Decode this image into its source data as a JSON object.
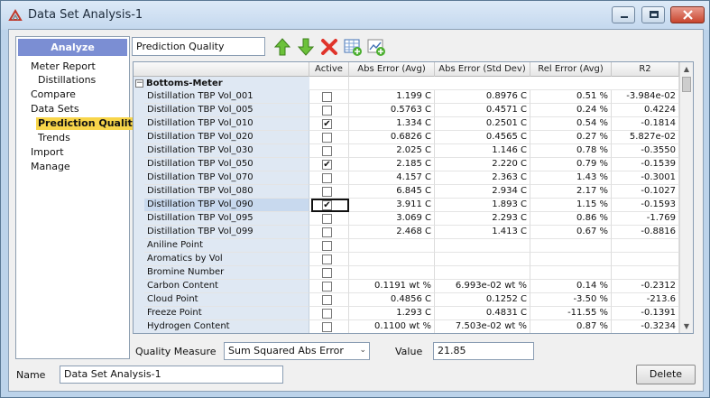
{
  "window": {
    "title": "Data Set Analysis-1"
  },
  "nav": {
    "header": "Analyze",
    "items": [
      {
        "label": "Meter Report",
        "level": 0,
        "selected": false
      },
      {
        "label": "Distillations",
        "level": 1,
        "selected": false
      },
      {
        "label": "Compare",
        "level": 0,
        "selected": false
      },
      {
        "label": "Data Sets",
        "level": 0,
        "selected": false
      },
      {
        "label": "Prediction Quality",
        "level": 1,
        "selected": true
      },
      {
        "label": "Trends",
        "level": 1,
        "selected": false
      },
      {
        "label": "Import",
        "level": 0,
        "selected": false
      },
      {
        "label": "Manage",
        "level": 0,
        "selected": false
      }
    ]
  },
  "toolbar": {
    "profile_value": "Prediction Quality",
    "icons": [
      "move-up-icon",
      "move-down-icon",
      "delete-icon",
      "add-column-icon",
      "add-chart-icon"
    ]
  },
  "grid": {
    "columns": [
      "",
      "Active",
      "Abs Error (Avg)",
      "Abs Error (Std Dev)",
      "Rel Error (Avg)",
      "R2"
    ],
    "group": "Bottoms-Meter",
    "rows": [
      {
        "name": "Distillation TBP Vol_001",
        "active": false,
        "abs_avg": "1.199 C",
        "abs_std": "0.8976 C",
        "rel_avg": "0.51 %",
        "r2": "-3.984e-02"
      },
      {
        "name": "Distillation TBP Vol_005",
        "active": false,
        "abs_avg": "0.5763 C",
        "abs_std": "0.4571 C",
        "rel_avg": "0.24 %",
        "r2": "0.4224"
      },
      {
        "name": "Distillation TBP Vol_010",
        "active": true,
        "abs_avg": "1.334 C",
        "abs_std": "0.2501 C",
        "rel_avg": "0.54 %",
        "r2": "-0.1814"
      },
      {
        "name": "Distillation TBP Vol_020",
        "active": false,
        "abs_avg": "0.6826 C",
        "abs_std": "0.4565 C",
        "rel_avg": "0.27 %",
        "r2": "5.827e-02"
      },
      {
        "name": "Distillation TBP Vol_030",
        "active": false,
        "abs_avg": "2.025 C",
        "abs_std": "1.146 C",
        "rel_avg": "0.78 %",
        "r2": "-0.3550"
      },
      {
        "name": "Distillation TBP Vol_050",
        "active": true,
        "abs_avg": "2.185 C",
        "abs_std": "2.220 C",
        "rel_avg": "0.79 %",
        "r2": "-0.1539"
      },
      {
        "name": "Distillation TBP Vol_070",
        "active": false,
        "abs_avg": "4.157 C",
        "abs_std": "2.363 C",
        "rel_avg": "1.43 %",
        "r2": "-0.3001"
      },
      {
        "name": "Distillation TBP Vol_080",
        "active": false,
        "abs_avg": "6.845 C",
        "abs_std": "2.934 C",
        "rel_avg": "2.17 %",
        "r2": "-0.1027"
      },
      {
        "name": "Distillation TBP Vol_090",
        "active": true,
        "selected": true,
        "abs_avg": "3.911 C",
        "abs_std": "1.893 C",
        "rel_avg": "1.15 %",
        "r2": "-0.1593"
      },
      {
        "name": "Distillation TBP Vol_095",
        "active": false,
        "abs_avg": "3.069 C",
        "abs_std": "2.293 C",
        "rel_avg": "0.86 %",
        "r2": "-1.769"
      },
      {
        "name": "Distillation TBP Vol_099",
        "active": false,
        "abs_avg": "2.468 C",
        "abs_std": "1.413 C",
        "rel_avg": "0.67 %",
        "r2": "-0.8816"
      },
      {
        "name": "Aniline Point",
        "active": false,
        "abs_avg": "",
        "abs_std": "",
        "rel_avg": "",
        "r2": ""
      },
      {
        "name": "Aromatics by Vol",
        "active": false,
        "abs_avg": "",
        "abs_std": "",
        "rel_avg": "",
        "r2": ""
      },
      {
        "name": "Bromine Number",
        "active": false,
        "abs_avg": "",
        "abs_std": "",
        "rel_avg": "",
        "r2": ""
      },
      {
        "name": "Carbon Content",
        "active": false,
        "abs_avg": "0.1191 wt %",
        "abs_std": "6.993e-02 wt %",
        "rel_avg": "0.14 %",
        "r2": "-0.2312"
      },
      {
        "name": "Cloud Point",
        "active": false,
        "abs_avg": "0.4856 C",
        "abs_std": "0.1252 C",
        "rel_avg": "-3.50 %",
        "r2": "-213.6"
      },
      {
        "name": "Freeze Point",
        "active": false,
        "abs_avg": "1.293 C",
        "abs_std": "0.4831 C",
        "rel_avg": "-11.55 %",
        "r2": "-0.1391"
      },
      {
        "name": "Hydrogen Content",
        "active": false,
        "abs_avg": "0.1100 wt %",
        "abs_std": "7.503e-02 wt %",
        "rel_avg": "0.87 %",
        "r2": "-0.3234"
      }
    ]
  },
  "bottom": {
    "quality_label": "Quality Measure",
    "quality_value": "Sum Squared Abs Error",
    "value_label": "Value",
    "value": "21.85",
    "name_label": "Name",
    "name_value": "Data Set Analysis-1",
    "delete_label": "Delete"
  },
  "colors": {
    "nav_header": "#7b8ed3",
    "selected_nav": "#f8d54a",
    "name_column": "#dfe8f3"
  }
}
